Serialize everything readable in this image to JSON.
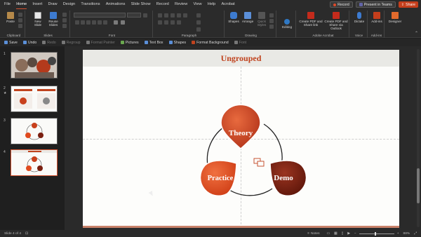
{
  "menu": {
    "items": [
      "File",
      "Home",
      "Insert",
      "Draw",
      "Design",
      "Transitions",
      "Animations",
      "Slide Show",
      "Record",
      "Review",
      "View",
      "Help",
      "Acrobat"
    ],
    "active_index": 1,
    "record_label": "Record",
    "present_label": "Present in Teams",
    "share_label": "Share"
  },
  "ribbon": {
    "paste_label": "Paste",
    "clipboard_label": "Clipboard",
    "new_slide_label": "New Slide",
    "reuse_slides_label": "Reuse Slides",
    "slides_label": "Slides",
    "font_label": "Font",
    "paragraph_label": "Paragraph",
    "shapes_label": "Shapes",
    "arrange_label": "Arrange",
    "quick_styles_label": "Quick Styles",
    "drawing_label": "Drawing",
    "editing_label": "Editing",
    "create_pdf_label": "Create PDF and Share link",
    "create_pdf_outlook_label": "Create PDF and Share via Outlook",
    "adobe_label": "Adobe Acrobat",
    "dictate_label": "Dictate",
    "voice_label": "Voice",
    "addins_label": "Add-ins",
    "addins_group_label": "Add-ins",
    "designer_label": "Designer"
  },
  "qat": {
    "items": [
      {
        "label": "Save",
        "enabled": true
      },
      {
        "label": "Undo",
        "enabled": true
      },
      {
        "label": "Redo",
        "enabled": false
      },
      {
        "label": "Regroup",
        "enabled": false
      },
      {
        "label": "Format Painter",
        "enabled": false
      },
      {
        "label": "Pictures",
        "enabled": true
      },
      {
        "label": "Text Box",
        "enabled": true
      },
      {
        "label": "Shapes",
        "enabled": true
      },
      {
        "label": "Format Background",
        "enabled": true
      },
      {
        "label": "Font",
        "enabled": false
      }
    ]
  },
  "thumbnails": [
    {
      "number": "1"
    },
    {
      "number": "2"
    },
    {
      "number": "3"
    },
    {
      "number": "4",
      "selected": true
    }
  ],
  "slide": {
    "title": "Ungrouped",
    "cycle": {
      "top_label": "Theory",
      "right_label": "Demo",
      "left_label": "Practice"
    }
  },
  "status": {
    "slide_info": "Slide 4 of 4",
    "notes_label": "Notes",
    "zoom": "88%"
  },
  "colors": {
    "accent": "#c0431e",
    "theory_fill": "#c8401c",
    "demo_fill": "#7a1f10",
    "practice_fill": "#e04a1e",
    "share_button": "#c43e1c"
  }
}
